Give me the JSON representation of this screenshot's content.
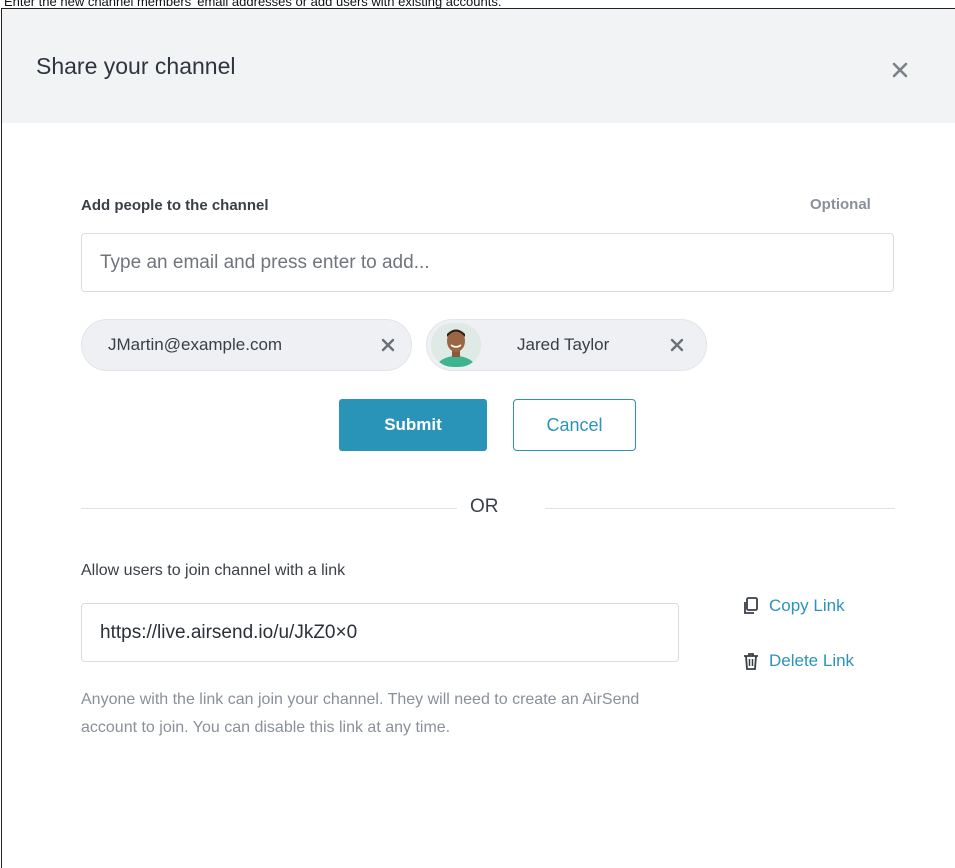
{
  "caption": "Enter the new channel members' email addresses or add users with existing accounts.",
  "dialog": {
    "title": "Share your channel"
  },
  "add_people": {
    "label": "Add people to the channel",
    "optional": "Optional",
    "input_placeholder": "Type an email and press enter to add...",
    "chips": [
      {
        "label": "JMartin@example.com",
        "has_avatar": false
      },
      {
        "label": "Jared Taylor",
        "has_avatar": true
      }
    ],
    "submit_label": "Submit",
    "cancel_label": "Cancel"
  },
  "divider": {
    "text": "OR"
  },
  "link_section": {
    "label": "Allow users to join channel with a link",
    "link_value": "https://live.airsend.io/u/JkZ0×0",
    "copy_label": "Copy Link",
    "delete_label": "Delete Link",
    "helper": "Anyone with the link can join your channel. They will need to create an AirSend account to join. You can disable this link at any time."
  },
  "colors": {
    "accent": "#2a94b8",
    "header_bg": "#f2f3f5",
    "muted_text": "#8a9099"
  }
}
